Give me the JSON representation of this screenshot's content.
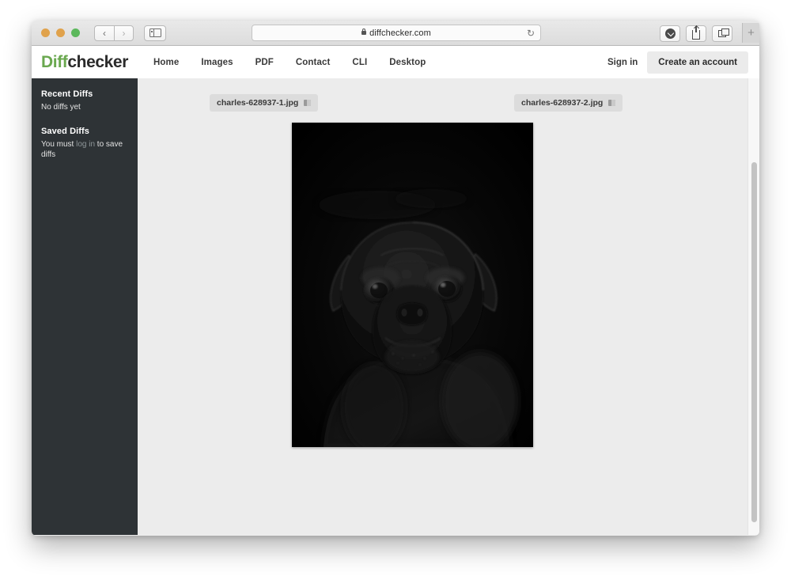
{
  "browser": {
    "url": "diffchecker.com",
    "lock_icon": "lock-icon",
    "reload_icon": "↻",
    "back_icon": "‹",
    "forward_icon": "›",
    "sidebar_toggle_icon": "sidebar-toggle-icon",
    "download_icon": "download-icon",
    "share_icon": "share-icon",
    "tabs_icon": "tabs-overview-icon",
    "new_tab_label": "+",
    "traffic_lights": [
      "close",
      "minimize",
      "zoom"
    ]
  },
  "site": {
    "logo": {
      "first": "Diff",
      "second": "checker",
      "first_color": "#6aa84f",
      "second_color": "#2b2b2b"
    },
    "nav": [
      {
        "label": "Home"
      },
      {
        "label": "Images"
      },
      {
        "label": "PDF"
      },
      {
        "label": "Contact"
      },
      {
        "label": "CLI"
      },
      {
        "label": "Desktop"
      }
    ],
    "sign_in_label": "Sign in",
    "create_account_label": "Create an account"
  },
  "sidebar": {
    "recent": {
      "heading": "Recent Diffs",
      "body": "No diffs yet"
    },
    "saved": {
      "heading": "Saved Diffs",
      "body_before": "You must ",
      "link": "log in",
      "body_after": " to save diffs"
    }
  },
  "main": {
    "files": [
      {
        "name": "charles-628937-1.jpg",
        "icon": "copy-icon"
      },
      {
        "name": "charles-628937-2.jpg",
        "icon": "copy-icon"
      }
    ],
    "diff_image": {
      "alt": "black pug portrait image diff result",
      "background_color": "#000000"
    }
  },
  "colors": {
    "sidebar_bg": "#2e3336",
    "content_bg": "#ececec",
    "header_bg": "#ffffff",
    "accent_green": "#6aa84f",
    "chip_bg": "#dcdcdc"
  }
}
